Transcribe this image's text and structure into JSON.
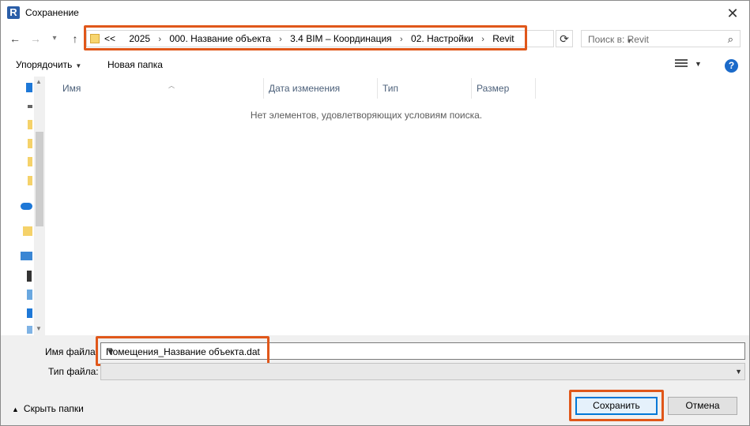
{
  "window": {
    "app_icon_letter": "R",
    "title": "Сохранение",
    "close_glyph": "✕"
  },
  "nav": {
    "back_glyph": "←",
    "forward_glyph": "→",
    "recent_glyph": "▾",
    "up_glyph": "↑",
    "breadcrumb_overflow": "<<",
    "breadcrumbs": [
      "2025",
      "000. Название объекта",
      "3.4 BIM – Координация",
      "02. Настройки",
      "Revit"
    ],
    "breadcrumb_separator": "›",
    "refresh_glyph": "⟳",
    "search_placeholder": "Поиск в: Revit",
    "search_glyph": "⌕"
  },
  "toolbar": {
    "organize_label": "Упорядочить",
    "new_folder_label": "Новая папка",
    "help_glyph": "?"
  },
  "navpane": {
    "icons": [
      "pc-icon",
      "drive-icon",
      "folder-icon",
      "folder-icon",
      "folder-icon",
      "folder-icon",
      "onedrive-icon",
      "quick-access-icon",
      "computer-icon",
      "usb-icon",
      "document-icon",
      "download-icon",
      "image-icon"
    ]
  },
  "filelist": {
    "columns": [
      "Имя",
      "Дата изменения",
      "Тип",
      "Размер"
    ],
    "empty_message": "Нет элементов, удовлетворяющих условиям поиска."
  },
  "bottom": {
    "filename_label": "Имя файла:",
    "filename_value": "Помещения_Название объекта.dat",
    "filetype_label": "Тип файла:",
    "filetype_value": "",
    "hide_folders_label": "Скрыть папки",
    "save_label": "Сохранить",
    "cancel_label": "Отмена"
  },
  "colors": {
    "highlight": "#e0571a",
    "accent": "#0078d7",
    "help": "#1b6ac9"
  }
}
